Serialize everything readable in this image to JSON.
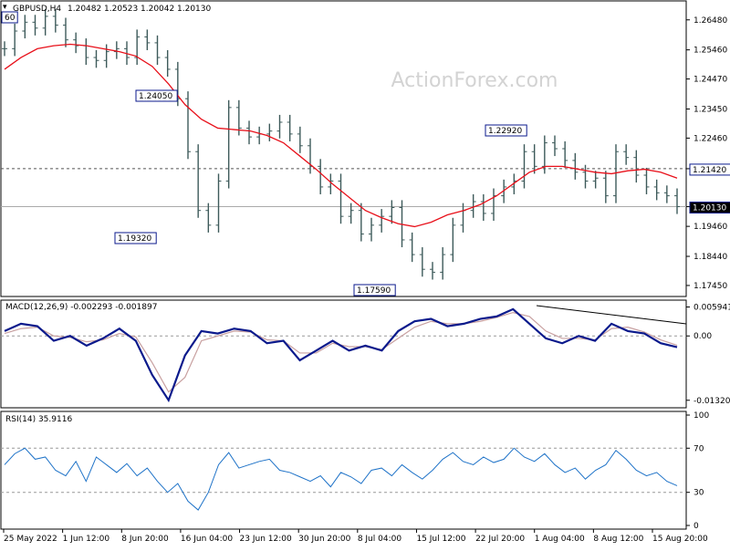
{
  "header": {
    "symbol_label": "GBPUSD,H4",
    "ohlc": [
      "1.20482",
      "1.20523",
      "1.20042",
      "1.20130"
    ]
  },
  "watermark": "ActionForex.com",
  "colors": {
    "bar": "#3d5a5a",
    "sma": "#e8101a",
    "macd": "#0b1a8c",
    "signal": "#c8a0a0",
    "rsi": "#1f73c8",
    "label_border": "#0b1a8c",
    "dotted": "#555555"
  },
  "chart_data": [
    {
      "type": "candlestick",
      "pane": "price",
      "title": "GBPUSD,H4",
      "ylim": [
        1.172,
        1.27
      ],
      "yticks": [
        "1.26480",
        "1.25460",
        "1.24470",
        "1.23450",
        "1.22460",
        "1.21420",
        "1.20130",
        "1.19460",
        "1.18440",
        "1.17450"
      ],
      "ytick_values": [
        1.2648,
        1.2546,
        1.2447,
        1.2345,
        1.2246,
        1.2142,
        1.2013,
        1.1946,
        1.1844,
        1.1745
      ],
      "x_labels": [
        "25 May 2022",
        "1 Jun 12:00",
        "8 Jun 20:00",
        "16 Jun 04:00",
        "23 Jun 12:00",
        "30 Jun 20:00",
        "8 Jul 04:00",
        "15 Jul 12:00",
        "22 Jul 20:00",
        "1 Aug 04:00",
        "8 Aug 12:00",
        "15 Aug 20:00"
      ],
      "series": [
        {
          "kind": "close",
          "values": [
            1.255,
            1.261,
            1.264,
            1.262,
            1.266,
            1.263,
            1.258,
            1.256,
            1.252,
            1.251,
            1.254,
            1.255,
            1.252,
            1.259,
            1.257,
            1.252,
            1.248,
            1.238,
            1.22,
            1.2,
            1.195,
            1.21,
            1.235,
            1.228,
            1.225,
            1.226,
            1.227,
            1.23,
            1.226,
            1.222,
            1.215,
            1.208,
            1.21,
            1.198,
            1.2,
            1.192,
            1.195,
            1.198,
            1.201,
            1.19,
            1.185,
            1.18,
            1.179,
            1.185,
            1.195,
            1.2,
            1.203,
            1.199,
            1.205,
            1.208,
            1.21,
            1.22,
            1.215,
            1.223,
            1.221,
            1.217,
            1.213,
            1.21,
            1.211,
            1.205,
            1.22,
            1.218,
            1.212,
            1.208,
            1.206,
            1.205,
            1.2013
          ]
        },
        {
          "kind": "sma",
          "values": [
            1.248,
            1.252,
            1.255,
            1.256,
            1.2565,
            1.256,
            1.255,
            1.254,
            1.2525,
            1.249,
            1.243,
            1.236,
            1.231,
            1.228,
            1.2275,
            1.227,
            1.2255,
            1.223,
            1.2185,
            1.214,
            1.209,
            1.2045,
            1.2,
            1.1975,
            1.1955,
            1.1945,
            1.196,
            1.1985,
            1.2,
            1.202,
            1.205,
            1.209,
            1.213,
            1.215,
            1.215,
            1.214,
            1.213,
            1.2125,
            1.2135,
            1.214,
            1.213,
            1.211
          ]
        }
      ],
      "annotations": [
        {
          "text": "60"
        },
        {
          "text": "1.24050"
        },
        {
          "text": "1.19320"
        },
        {
          "text": "1.17590"
        },
        {
          "text": "1.22920"
        },
        {
          "text": "1.21420",
          "value": 1.2142
        },
        {
          "text": "1.20130",
          "value": 1.2013
        }
      ]
    },
    {
      "type": "line",
      "pane": "macd",
      "title": "MACD(12,26,9) -0.002293 -0.001897",
      "ylim": [
        -0.014,
        0.0066
      ],
      "yticks": [
        "0.005941",
        "0.00",
        "-0.013207"
      ],
      "ytick_values": [
        0.005941,
        0.0,
        -0.013207
      ],
      "series": [
        {
          "name": "MACD",
          "values": [
            0.001,
            0.0025,
            0.002,
            -0.001,
            0.0,
            -0.002,
            -0.0005,
            0.0015,
            -0.001,
            -0.008,
            -0.0132,
            -0.004,
            0.001,
            0.0005,
            0.0015,
            0.001,
            -0.0015,
            -0.001,
            -0.005,
            -0.003,
            -0.001,
            -0.003,
            -0.002,
            -0.003,
            0.001,
            0.003,
            0.0035,
            0.002,
            0.0025,
            0.0035,
            0.004,
            0.0055,
            0.0025,
            -0.0005,
            -0.0015,
            0.0,
            -0.001,
            0.0025,
            0.001,
            0.0005,
            -0.0015,
            -0.0023
          ]
        },
        {
          "name": "Signal",
          "values": [
            0.0005,
            0.0015,
            0.0018,
            0.0,
            -0.0003,
            -0.0012,
            -0.0008,
            0.0005,
            -0.0002,
            -0.0055,
            -0.0115,
            -0.0085,
            -0.001,
            0.0,
            0.001,
            0.0008,
            -0.0008,
            -0.001,
            -0.0035,
            -0.0035,
            -0.0015,
            -0.0022,
            -0.0022,
            -0.0028,
            -0.0005,
            0.0018,
            0.003,
            0.0025,
            0.0025,
            0.003,
            0.0038,
            0.0048,
            0.004,
            0.001,
            -0.0005,
            -0.0005,
            -0.0008,
            0.0015,
            0.0018,
            0.0008,
            -0.0008,
            -0.0019
          ]
        }
      ]
    },
    {
      "type": "line",
      "pane": "rsi",
      "title": "RSI(14) 35.9116",
      "ylim": [
        0,
        100
      ],
      "yticks": [
        "100",
        "70",
        "30",
        "0"
      ],
      "ytick_values": [
        100,
        70,
        30,
        0
      ],
      "levels": [
        70,
        30
      ],
      "series": [
        {
          "name": "RSI(14)",
          "values": [
            55,
            65,
            70,
            60,
            62,
            50,
            45,
            58,
            40,
            62,
            55,
            48,
            56,
            45,
            52,
            40,
            30,
            38,
            22,
            14,
            30,
            55,
            66,
            52,
            55,
            58,
            60,
            50,
            48,
            44,
            40,
            45,
            35,
            48,
            44,
            38,
            50,
            52,
            45,
            55,
            48,
            42,
            50,
            60,
            66,
            58,
            55,
            62,
            57,
            60,
            70,
            62,
            58,
            65,
            55,
            48,
            52,
            42,
            50,
            55,
            68,
            60,
            50,
            45,
            48,
            40,
            36
          ]
        }
      ]
    }
  ]
}
